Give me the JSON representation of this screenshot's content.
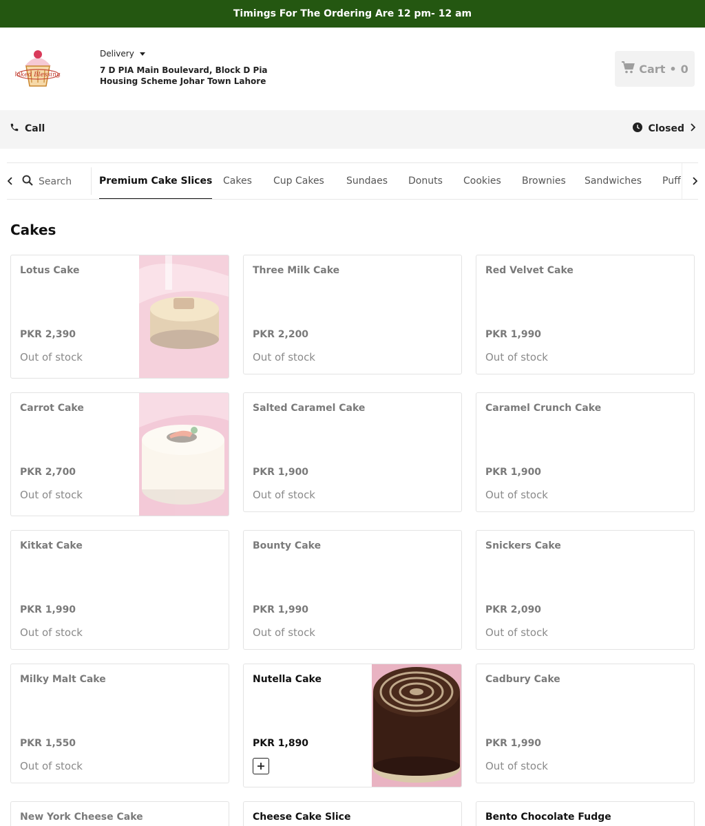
{
  "banner": {
    "text": "Timings For The Ordering Are 12 pm- 12 am",
    "color": "#245711"
  },
  "header": {
    "logo_text": "Baked Blessings",
    "delivery_label": "Delivery",
    "address": "7 D PIA Main Boulevard, Block D Pia Housing Scheme Johar Town Lahore",
    "cart": {
      "label": "Cart",
      "separator": "•",
      "count": "0"
    }
  },
  "infobar": {
    "call_label": "Call",
    "status_label": "Closed"
  },
  "tabs": {
    "search_label": "Search",
    "items": [
      {
        "label": "Premium Cake Slices",
        "active": true
      },
      {
        "label": "Cakes"
      },
      {
        "label": "Cup Cakes"
      },
      {
        "label": "Sundaes"
      },
      {
        "label": "Donuts"
      },
      {
        "label": "Cookies"
      },
      {
        "label": "Brownies"
      },
      {
        "label": "Sandwiches"
      },
      {
        "label": "Puff"
      }
    ]
  },
  "section": {
    "title": "Cakes"
  },
  "products": [
    {
      "name": "Lotus Cake",
      "price": "PKR 2,390",
      "stock": "Out of stock"
    },
    {
      "name": "Three Milk Cake",
      "price": "PKR 2,200",
      "stock": "Out of stock"
    },
    {
      "name": "Red Velvet Cake",
      "price": "PKR 1,990",
      "stock": "Out of stock"
    },
    {
      "name": "Carrot Cake",
      "price": "PKR 2,700",
      "stock": "Out of stock"
    },
    {
      "name": "Salted Caramel Cake",
      "price": "PKR 1,900",
      "stock": "Out of stock"
    },
    {
      "name": "Caramel Crunch Cake",
      "price": "PKR 1,900",
      "stock": "Out of stock"
    },
    {
      "name": "Kitkat Cake",
      "price": "PKR 1,990",
      "stock": "Out of stock"
    },
    {
      "name": "Bounty Cake",
      "price": "PKR 1,990",
      "stock": "Out of stock"
    },
    {
      "name": "Snickers Cake",
      "price": "PKR 2,090",
      "stock": "Out of stock"
    },
    {
      "name": "Milky Malt Cake",
      "price": "PKR 1,550",
      "stock": "Out of stock"
    },
    {
      "name": "Nutella Cake",
      "price": "PKR 1,890"
    },
    {
      "name": "Cadbury Cake",
      "price": "PKR 1,990",
      "stock": "Out of stock"
    },
    {
      "name": "New York Cheese Cake"
    },
    {
      "name": "Cheese Cake Slice"
    },
    {
      "name": "Bento Chocolate Fudge"
    }
  ]
}
